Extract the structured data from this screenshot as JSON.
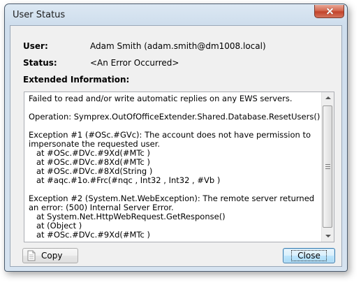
{
  "window": {
    "title": "User Status"
  },
  "fields": {
    "user_label": "User:",
    "user_value": "Adam Smith (adam.smith@dm1008.local)",
    "status_label": "Status:",
    "status_value": "<An Error Occurred>",
    "extended_label": "Extended Information:"
  },
  "details": {
    "text": "Failed to read and/or write automatic replies on any EWS servers.\n\nOperation: Symprex.OutOfOfficeExtender.Shared.Database.ResetUsers()\n\nException #1 (#OSc.#GVc): The account does not have permission to impersonate the requested user.\n   at #OSc.#DVc.#9Xd(#MTc )\n   at #OSc.#DVc.#8Xd(#MTc )\n   at #OSc.#DVc.#8Xd(String )\n   at #aqc.#1o.#Frc(#nqc , Int32 , Int32 , #Vb )\n\nException #2 (System.Net.WebException): The remote server returned an error: (500) Internal Server Error.\n   at System.Net.HttpWebRequest.GetResponse()\n   at (Object )\n   at #OSc.#DVc.#9Xd(#MTc )"
  },
  "buttons": {
    "copy_label": "Copy",
    "close_label": "Close"
  },
  "icons": {
    "window_close": "close-icon",
    "copy": "copy-document-icon",
    "scroll_up": "chevron-up-icon",
    "scroll_down": "chevron-down-icon"
  }
}
